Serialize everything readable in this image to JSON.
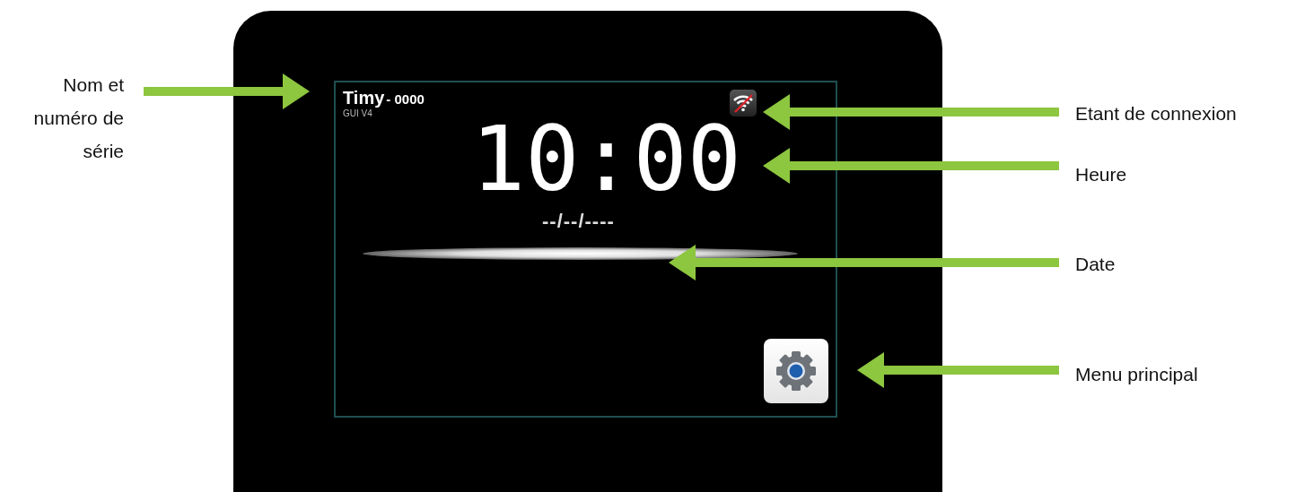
{
  "screen": {
    "name": "Timy",
    "serial": "- 0000",
    "version": "GUI V4",
    "connected": false,
    "time": "10:00",
    "date": "--/--/----"
  },
  "left_annotations": [
    "Nom et numéro de série"
  ],
  "right_annotations": [
    "Etant de connexion",
    "Heure",
    "Date",
    "Menu principal"
  ]
}
